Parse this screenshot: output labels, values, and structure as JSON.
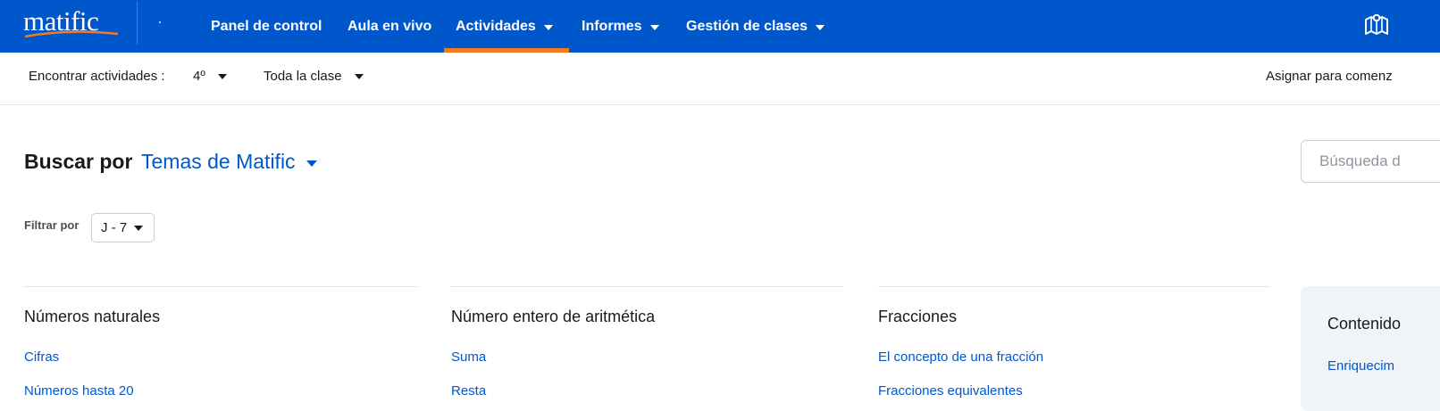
{
  "brand": {
    "logo_text": "matific"
  },
  "nav": {
    "items": [
      {
        "label": "Panel de control",
        "has_menu": false
      },
      {
        "label": "Aula en vivo",
        "has_menu": false
      },
      {
        "label": "Actividades",
        "has_menu": true,
        "active": true
      },
      {
        "label": "Informes",
        "has_menu": true
      },
      {
        "label": "Gestión de clases",
        "has_menu": true
      }
    ],
    "active_color": "#f47b20",
    "background": "#0057cc",
    "right_icon": "map-icon"
  },
  "subbar": {
    "find_label": "Encontrar actividades :",
    "grade": "4º",
    "class": "Toda la clase",
    "assign": "Asignar para comenz"
  },
  "browse": {
    "label": "Buscar por",
    "topic": "Temas de Matific",
    "search_placeholder": "Búsqueda d"
  },
  "filter": {
    "label": "Filtrar por",
    "value": "J - 7"
  },
  "columns": [
    {
      "title": "Números naturales",
      "links": [
        "Cifras",
        "Números hasta 20"
      ]
    },
    {
      "title": "Número entero de aritmética",
      "links": [
        "Suma",
        "Resta"
      ]
    },
    {
      "title": "Fracciones",
      "links": [
        "El concepto de una fracción",
        "Fracciones equivalentes"
      ]
    }
  ],
  "side_panel": {
    "title": "Contenido",
    "link": "Enriquecim"
  }
}
